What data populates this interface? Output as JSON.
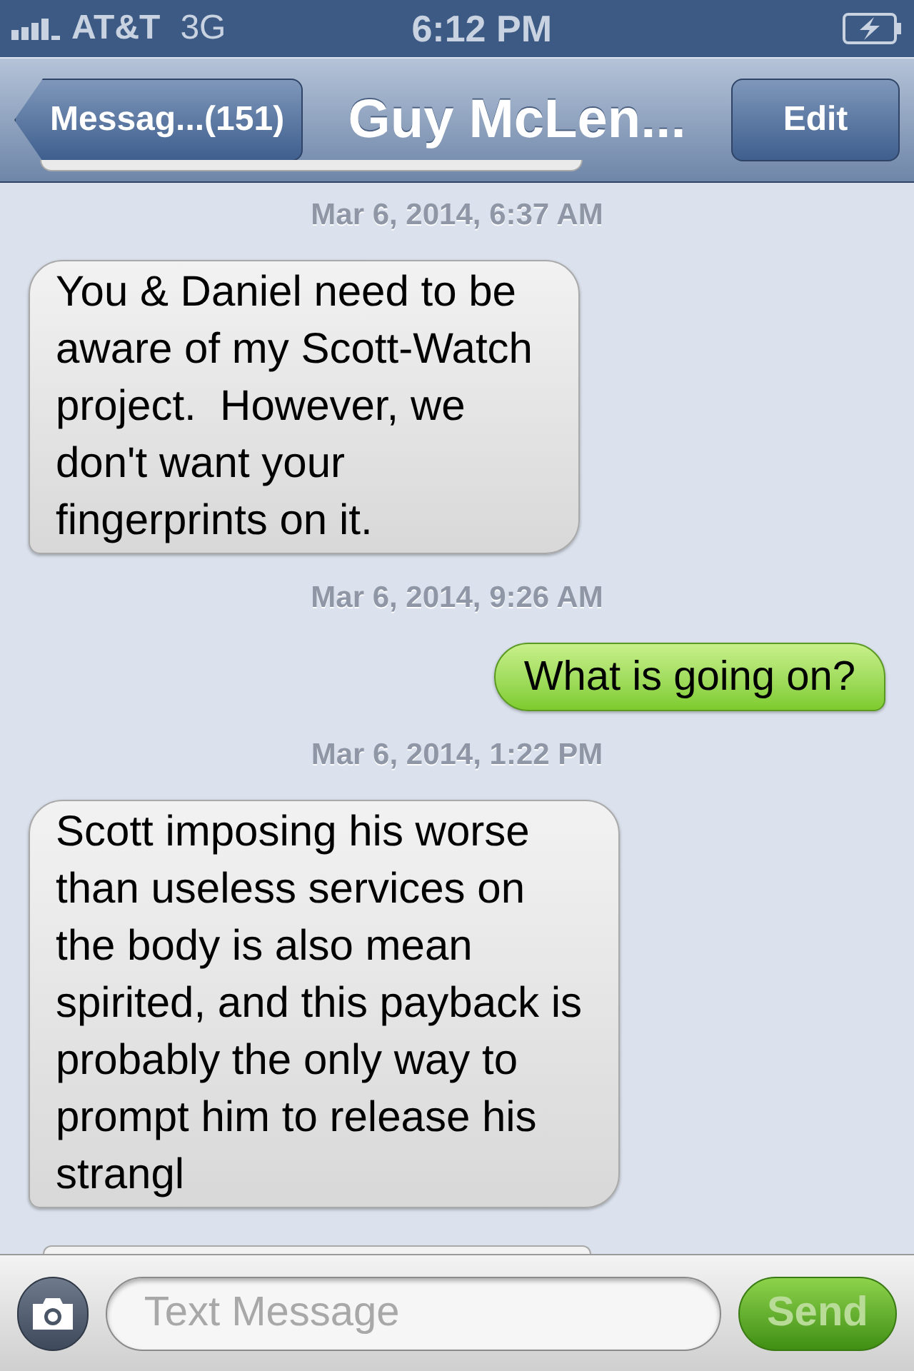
{
  "status_bar": {
    "carrier": "AT&T",
    "network": "3G",
    "time": "6:12 PM",
    "charging": true
  },
  "nav_bar": {
    "back": "Messag...(151)",
    "title": "Guy McLen...",
    "edit": "Edit"
  },
  "messages": [
    {
      "kind": "timestamp",
      "text": "Mar 6, 2014, 6:37 AM"
    },
    {
      "kind": "incoming",
      "text": "You & Daniel need to be aware of my Scott-Watch project.  However, we don't want your fingerprints on it."
    },
    {
      "kind": "timestamp",
      "text": "Mar 6, 2014, 9:26 AM"
    },
    {
      "kind": "outgoing",
      "text": "What is going on?"
    },
    {
      "kind": "timestamp",
      "text": "Mar 6, 2014, 1:22 PM"
    },
    {
      "kind": "incoming",
      "text": "Scott imposing his worse than useless services on the body is also mean spirited, and this payback is probably the only way to prompt him to release his strangl"
    }
  ],
  "composer": {
    "placeholder": "Text Message",
    "send": "Send",
    "send_disabled": true
  }
}
